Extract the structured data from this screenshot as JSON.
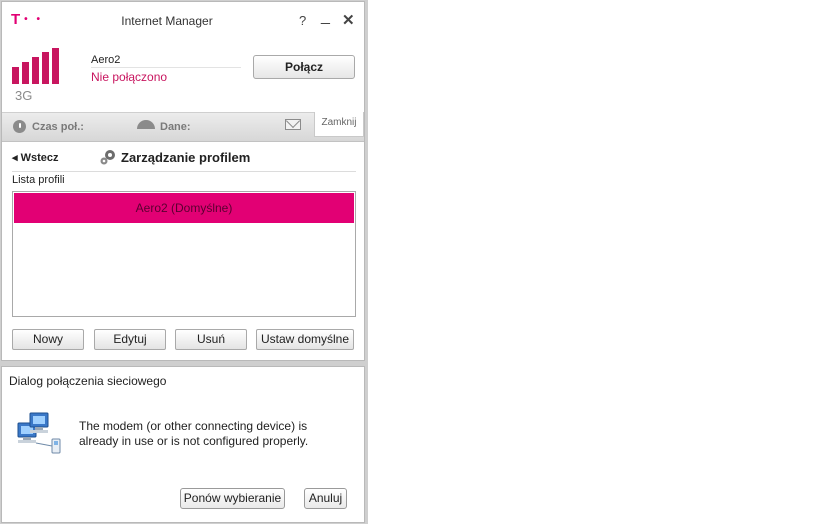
{
  "window": {
    "title": "Internet Manager",
    "help": "?",
    "minimize": "_",
    "close": "✕"
  },
  "connection": {
    "network_type": "3G",
    "profile": "Aero2",
    "status": "Nie połączono",
    "connect_label": "Połącz"
  },
  "infobar": {
    "time_label": "Czas poł.:",
    "data_label": "Dane:",
    "close_tab": "Zamknij"
  },
  "profile_manager": {
    "back": "◂ Wstecz",
    "title": "Zarządzanie profilem",
    "list_label": "Lista profili",
    "profiles": [
      "Aero2 (Domyślne)"
    ],
    "buttons": {
      "new": "Nowy",
      "edit": "Edytuj",
      "delete": "Usuń",
      "set_default": "Ustaw domyślne"
    }
  },
  "dialog": {
    "title": "Dialog połączenia sieciowego",
    "message": "The modem (or other connecting device) is already in use or is not configured properly.",
    "redial": "Ponów wybieranie",
    "cancel": "Anuluj"
  },
  "colors": {
    "brand": "#e20074",
    "status": "#c8155f"
  },
  "icons": [
    "signal-strength-icon",
    "clock-icon",
    "gauge-icon",
    "envelope-icon",
    "gear-icon",
    "network-computers-icon"
  ]
}
